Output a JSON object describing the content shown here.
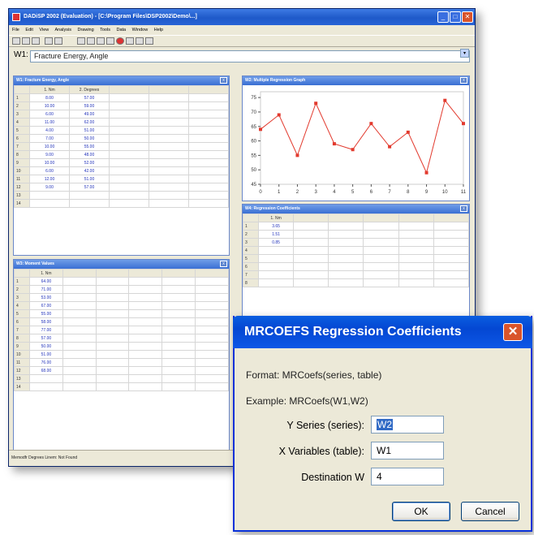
{
  "window": {
    "title": "DADiSP 2002 (Evaluation) - [C:\\Program Files\\DSP2002\\Demo\\...]",
    "minimize": "_",
    "maximize": "□",
    "close": "✕"
  },
  "menu": [
    "File",
    "Edit",
    "View",
    "Analysis",
    "Drawing",
    "Tools",
    "Data",
    "Window",
    "Help"
  ],
  "command": {
    "label": "W1:",
    "value": "Fracture Energy, Angle",
    "dropdown": "▾"
  },
  "w1": {
    "title": "W1: Fracture Energy, Angle",
    "columns": [
      "1. Nm",
      "2. Degrees"
    ],
    "rows": [
      [
        "8.00",
        "57.00"
      ],
      [
        "10.00",
        "59.00"
      ],
      [
        "6.00",
        "49.00"
      ],
      [
        "11.00",
        "62.00"
      ],
      [
        "4.00",
        "51.00"
      ],
      [
        "7.00",
        "50.00"
      ],
      [
        "10.00",
        "55.00"
      ],
      [
        "9.00",
        "48.00"
      ],
      [
        "10.00",
        "52.00"
      ],
      [
        "6.00",
        "42.00"
      ],
      [
        "12.00",
        "51.00"
      ],
      [
        "9.00",
        "57.00"
      ]
    ],
    "row_count": 14
  },
  "w2": {
    "title": "W2: Multiple Regression Graph",
    "chart_data": {
      "type": "line",
      "x": [
        0,
        1,
        2,
        3,
        4,
        5,
        6,
        7,
        8,
        9,
        10,
        11
      ],
      "values": [
        64,
        69,
        55,
        73,
        59,
        57,
        66,
        58,
        63,
        49,
        74,
        66
      ],
      "xticks": [
        "0",
        "1",
        "2",
        "3",
        "4",
        "5",
        "6",
        "7",
        "8",
        "9",
        "10",
        "11"
      ],
      "yticks": [
        "45",
        "50",
        "55",
        "60",
        "65",
        "70",
        "75"
      ],
      "ylim": [
        45,
        77
      ],
      "xlim": [
        0,
        11
      ],
      "color": "#e23a2e"
    }
  },
  "w3": {
    "title": "W3: Moment Values",
    "columns": [
      "1. Nm"
    ],
    "rows": [
      [
        "64.00"
      ],
      [
        "71.00"
      ],
      [
        "53.00"
      ],
      [
        "67.00"
      ],
      [
        "55.00"
      ],
      [
        "58.00"
      ],
      [
        "77.00"
      ],
      [
        "57.00"
      ],
      [
        "50.00"
      ],
      [
        "51.00"
      ],
      [
        "76.00"
      ],
      [
        "68.00"
      ]
    ],
    "row_count": 14
  },
  "w4": {
    "title": "W4: Regression Coefficients",
    "columns": [
      "1. Nm"
    ],
    "rows": [
      [
        "3.65"
      ],
      [
        "1.51"
      ],
      [
        "0.85"
      ]
    ],
    "row_count": 8
  },
  "status": "Memodfr Degrees Linem: Not Found",
  "dialog": {
    "title": "MRCOEFS  Regression Coefficients",
    "close": "✕",
    "format": "Format:  MRCoefs(series, table)",
    "example": "Example: MRCoefs(W1,W2)",
    "y_label": "Y Series (series):",
    "y_value": "W2",
    "x_label": "X Variables (table):",
    "x_value": "W1",
    "dest_label": "Destination W",
    "dest_value": "4",
    "ok": "OK",
    "cancel": "Cancel"
  },
  "colors": {
    "accent": "#0a5ee0",
    "grid_value": "#2233bb",
    "series": "#e23a2e"
  }
}
